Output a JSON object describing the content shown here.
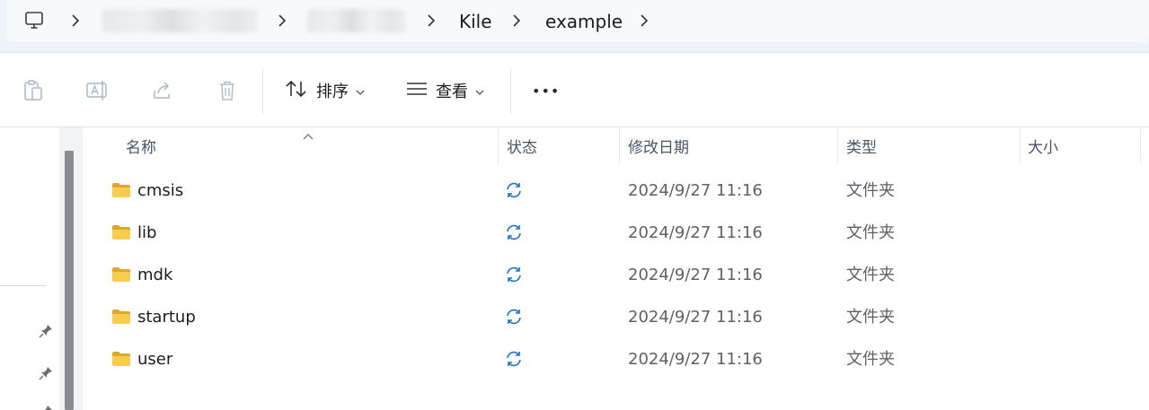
{
  "addressbar": {
    "crumbs": [
      {
        "label": ""
      },
      {
        "label": ""
      },
      {
        "label": "Kile"
      },
      {
        "label": "example"
      }
    ]
  },
  "toolbar": {
    "sort_label": "排序",
    "view_label": "查看",
    "more_label": "•••"
  },
  "list": {
    "columns": {
      "name": "名称",
      "status": "状态",
      "modified": "修改日期",
      "type": "类型",
      "size": "大小"
    },
    "rows": [
      {
        "name": "cmsis",
        "modified": "2024/9/27 11:16",
        "type": "文件夹",
        "size": ""
      },
      {
        "name": "lib",
        "modified": "2024/9/27 11:16",
        "type": "文件夹",
        "size": ""
      },
      {
        "name": "mdk",
        "modified": "2024/9/27 11:16",
        "type": "文件夹",
        "size": ""
      },
      {
        "name": "startup",
        "modified": "2024/9/27 11:16",
        "type": "文件夹",
        "size": ""
      },
      {
        "name": "user",
        "modified": "2024/9/27 11:16",
        "type": "文件夹",
        "size": ""
      }
    ]
  },
  "colors": {
    "accent": "#1a73c8",
    "folder": "#f6c544",
    "folder_dark": "#e0a82a"
  }
}
